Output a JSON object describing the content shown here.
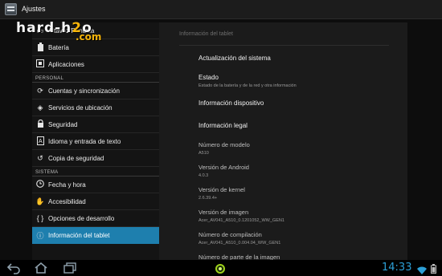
{
  "action_bar": {
    "title": "Ajustes",
    "icon": "settings-app-icon"
  },
  "watermark": {
    "line1_pre": "hard-h",
    "line1_o": "2",
    "line1_post": "o",
    "line2": ".com"
  },
  "sidebar": {
    "top_items": [
      {
        "label": "Altavoz/Pantalla",
        "icon": "display-icon"
      },
      {
        "label": "Batería",
        "icon": "battery-icon"
      },
      {
        "label": "Aplicaciones",
        "icon": "apps-icon"
      }
    ],
    "section_personal": "PERSONAL",
    "personal_items": [
      {
        "label": "Cuentas y sincronización",
        "icon": "sync-icon"
      },
      {
        "label": "Servicios de ubicación",
        "icon": "location-icon"
      },
      {
        "label": "Seguridad",
        "icon": "lock-icon"
      },
      {
        "label": "Idioma y entrada de texto",
        "icon": "language-icon"
      },
      {
        "label": "Copia de seguridad",
        "icon": "backup-icon"
      }
    ],
    "section_system": "SISTEMA",
    "system_items": [
      {
        "label": "Fecha y hora",
        "icon": "clock-icon"
      },
      {
        "label": "Accesibilidad",
        "icon": "hand-icon"
      },
      {
        "label": "Opciones de desarrollo",
        "icon": "braces-icon"
      },
      {
        "label": "Información del tablet",
        "icon": "info-icon",
        "selected": true
      }
    ]
  },
  "panel": {
    "title": "Información del tablet",
    "actualizacion": "Actualización del sistema",
    "estado": {
      "title": "Estado",
      "sub": "Estado de la batería y de la red y otra información"
    },
    "info_dispositivo": "Información dispositivo",
    "info_legal": "Información legal",
    "modelo": {
      "label": "Número de modelo",
      "value": "A510"
    },
    "android": {
      "label": "Versión de Android",
      "value": "4.0.3"
    },
    "kernel": {
      "label": "Versión de kernel",
      "value": "2.6.39.4+"
    },
    "imagen": {
      "label": "Versión de imagen",
      "value": "Acer_AV041_A510_0.1201052_WW_GEN1"
    },
    "compilacion": {
      "label": "Número de compilación",
      "value": "Acer_AV041_A510_0.004.04_WW_GEN1"
    },
    "pieza": {
      "label": "Número de parte de la imagen"
    }
  },
  "nav_bar": {
    "clock": "14:33",
    "icons": [
      "back-icon",
      "home-icon",
      "recent-apps-icon",
      "notification-dot-icon",
      "wifi-icon",
      "battery-status-icon"
    ],
    "accent": "#2c9fd6"
  }
}
